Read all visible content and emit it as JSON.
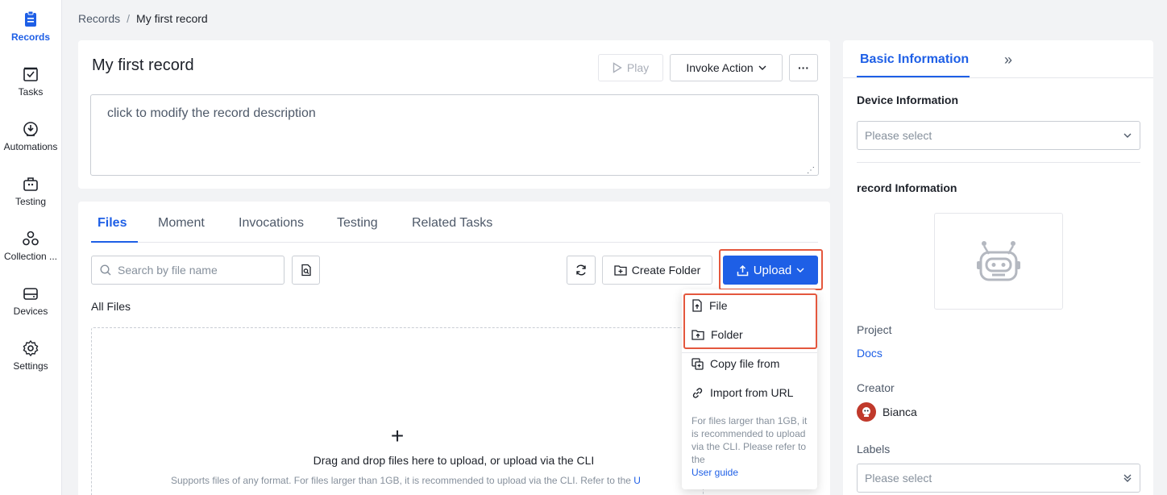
{
  "nav": {
    "items": [
      {
        "label": "Records",
        "icon": "records-icon",
        "active": true
      },
      {
        "label": "Tasks",
        "icon": "tasks-icon"
      },
      {
        "label": "Automations",
        "icon": "automations-icon"
      },
      {
        "label": "Testing",
        "icon": "testing-icon"
      },
      {
        "label": "Collection ...",
        "icon": "collection-icon"
      },
      {
        "label": "Devices",
        "icon": "devices-icon"
      },
      {
        "label": "Settings",
        "icon": "settings-icon"
      }
    ]
  },
  "breadcrumb": {
    "parent": "Records",
    "separator": "/",
    "current": "My first record"
  },
  "record": {
    "title": "My first record",
    "play_label": "Play",
    "invoke_label": "Invoke Action",
    "more_label": "···",
    "description": "click to modify the record description"
  },
  "files": {
    "tabs": [
      "Files",
      "Moment",
      "Invocations",
      "Testing",
      "Related Tasks"
    ],
    "active_tab": "Files",
    "search_placeholder": "Search by file name",
    "create_folder_label": "Create Folder",
    "upload_label": "Upload",
    "all_files_label": "All Files",
    "dropzone_main": "Drag and drop files here to upload, or upload via the CLI",
    "dropzone_sub": "Supports files of any format. For files larger than 1GB, it is recommended to upload via the CLI. Refer to the",
    "dropzone_link": "U"
  },
  "upload_menu": {
    "items": [
      {
        "label": "File",
        "icon": "file-upload-icon"
      },
      {
        "label": "Folder",
        "icon": "folder-upload-icon"
      },
      {
        "label": "Copy file from",
        "icon": "copy-icon"
      },
      {
        "label": "Import from URL",
        "icon": "link-icon"
      }
    ],
    "note": "For files larger than 1GB, it is recommended to upload via the CLI. Please refer to the",
    "note_link": "User guide"
  },
  "panel": {
    "tab_label": "Basic Information",
    "expand_label": "»",
    "device_info_label": "Device Information",
    "device_select_placeholder": "Please select",
    "record_info_label": "record Information",
    "project_label": "Project",
    "project_value": "Docs",
    "creator_label": "Creator",
    "creator_name": "Bianca",
    "labels_label": "Labels",
    "labels_placeholder": "Please select"
  },
  "colors": {
    "accent": "#1e5fe6",
    "highlight": "#e4573d"
  }
}
